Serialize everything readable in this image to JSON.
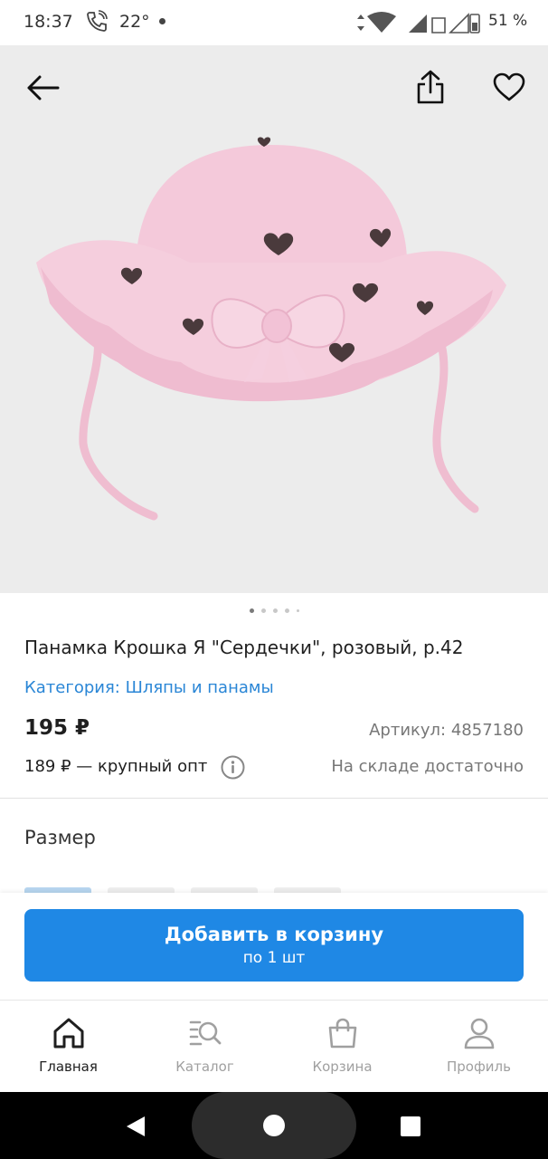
{
  "status_bar": {
    "time": "18:37",
    "temperature": "22°",
    "battery_percent": "51 %",
    "icons": [
      "call-icon",
      "signal-icon",
      "wifi-icon",
      "mobile-signal-icon",
      "battery-icon"
    ]
  },
  "image_controls": {
    "icons": [
      "back-arrow-icon",
      "share-icon",
      "heart-icon"
    ],
    "pager_count": 5,
    "pager_active_index": 0
  },
  "product": {
    "title": "Панамка Крошка Я \"Сердечки\", розовый, р.42",
    "category": "Категория: Шляпы и панамы",
    "price": "195 ₽",
    "sku": "Артикул: 4857180",
    "wholesale": "189 ₽ — крупный опт",
    "stock": "На складе достаточно"
  },
  "size": {
    "label": "Размер"
  },
  "cart": {
    "button_label": "Добавить в корзину",
    "button_sublabel": "по 1 шт"
  },
  "bottom_nav": {
    "items": [
      {
        "label": "Главная",
        "icon": "home-icon",
        "active": true
      },
      {
        "label": "Каталог",
        "icon": "catalog-search-icon",
        "active": false
      },
      {
        "label": "Корзина",
        "icon": "shopping-bag-icon",
        "active": false
      },
      {
        "label": "Профиль",
        "icon": "profile-icon",
        "active": false
      }
    ]
  },
  "colors": {
    "accent": "#1f88e5",
    "link": "#2a86d6",
    "image_background": "#ececec",
    "hat_pink": "#f3c8d8"
  }
}
